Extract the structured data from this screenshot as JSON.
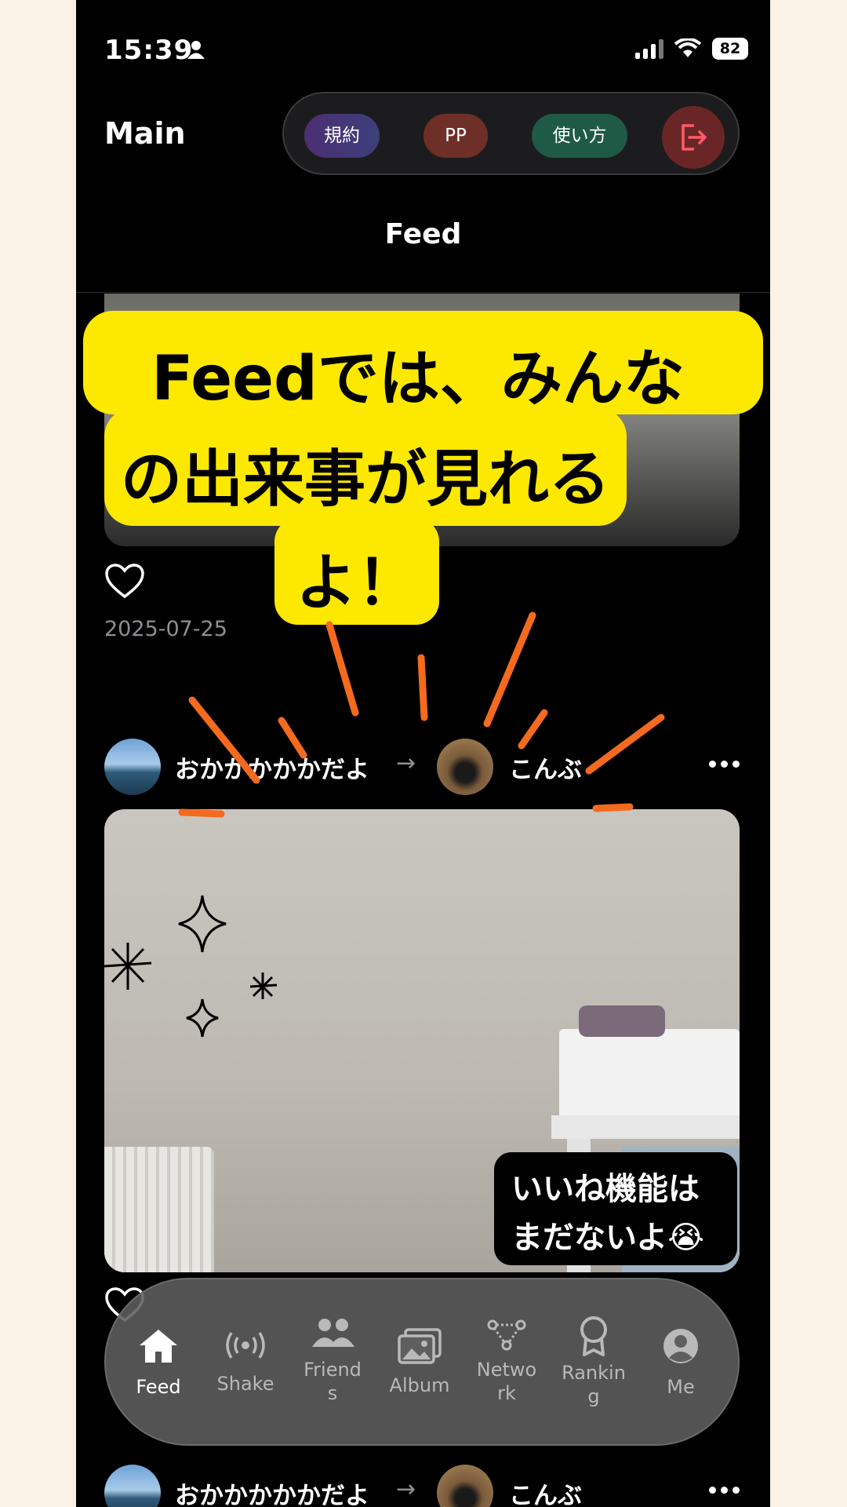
{
  "status_bar": {
    "time": "15:39",
    "battery": "82"
  },
  "header": {
    "title": "Main",
    "pills": [
      {
        "label": "規約",
        "color": "#4b2f73"
      },
      {
        "label": "PP",
        "color": "#6e2f28"
      },
      {
        "label": "使い方",
        "color": "#1f5a47"
      }
    ],
    "logout_icon": "logout-icon",
    "feed_title": "Feed"
  },
  "posts": [
    {
      "date": "2025-07-25",
      "liked": false
    },
    {
      "from_user": "おかかかかかだよ",
      "arrow": "→",
      "to_user": "こんぶ"
    },
    {
      "from_user": "おかかかかかだよ",
      "arrow": "→",
      "to_user": "こんぶ"
    }
  ],
  "overlay": {
    "banner_lines": [
      "Feedでは、みんな",
      "の出来事が見れる",
      "よ！"
    ],
    "note_lines": [
      "いいね機能は",
      "まだないよ😭"
    ],
    "accent_yellow": "#fde800",
    "accent_orange": "#f46a1f"
  },
  "tab_bar": {
    "items": [
      {
        "label": "Feed",
        "icon": "home-icon",
        "active": true
      },
      {
        "label": "Shake",
        "icon": "broadcast-icon"
      },
      {
        "label": "Friend\ns",
        "icon": "people-icon"
      },
      {
        "label": "Album",
        "icon": "photos-icon"
      },
      {
        "label": "Netwo\nrk",
        "icon": "network-icon"
      },
      {
        "label": "Rankin\ng",
        "icon": "ribbon-icon"
      },
      {
        "label": "Me",
        "icon": "person-icon"
      }
    ]
  }
}
